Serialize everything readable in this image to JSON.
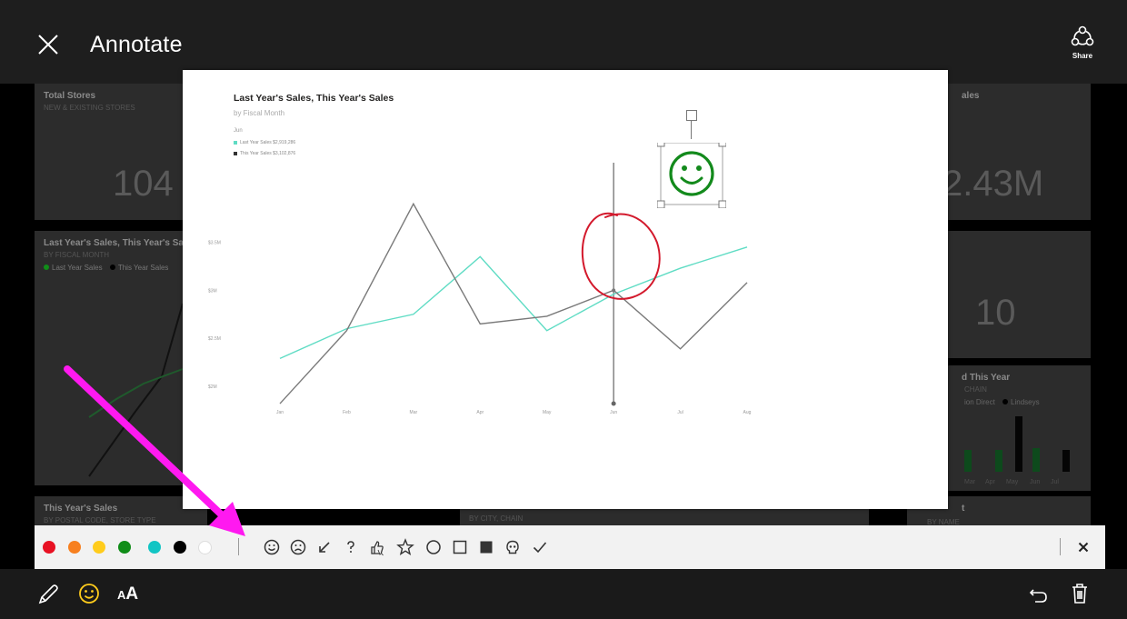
{
  "header": {
    "title": "Annotate",
    "share_label": "Share"
  },
  "background_dashboard": {
    "tile_total_stores": {
      "title": "Total Stores",
      "subtitle": "NEW & EXISTING STORES",
      "value": "104"
    },
    "tile_sales": {
      "title": "ales",
      "value": "2.43M"
    },
    "tile_count": {
      "value": "10"
    },
    "tile_line": {
      "title": "Last Year's Sales, This Year's Sa",
      "subtitle": "BY FISCAL MONTH",
      "legend": [
        "Last Year Sales",
        "This Year Sales"
      ]
    },
    "tile_bar": {
      "title": "d This Year",
      "subtitle": "CHAIN",
      "legend": [
        "ion Direct",
        "Lindseys"
      ],
      "xticks": [
        "Mar",
        "Apr",
        "May",
        "Jun",
        "Jul"
      ]
    },
    "tile_this_year": {
      "title": "This Year's Sales",
      "subtitle": "BY POSTAL CODE, STORE TYPE"
    },
    "tile_mid": {
      "subtitle": "BY CITY, CHAIN"
    },
    "tile_right": {
      "title": "t",
      "subtitle": "BY NAME"
    }
  },
  "chart_data": {
    "type": "line",
    "title": "Last Year's Sales, This Year's Sales",
    "subtitle": "by Fiscal Month",
    "legend_header": "Jun",
    "categories": [
      "Jan",
      "Feb",
      "Mar",
      "Apr",
      "May",
      "Jun",
      "Jul",
      "Aug"
    ],
    "y_ticks": [
      "$3.5M",
      "$3M",
      "$2.5M",
      "$2M"
    ],
    "ylim": [
      1.65,
      4.3
    ],
    "series": [
      {
        "name": "Last Year Sales",
        "legend_label": "Last Year Sales $2,919,286",
        "color": "#5fdcc4",
        "values": [
          2.29,
          2.6,
          2.75,
          3.35,
          2.58,
          2.96,
          3.23,
          3.45
        ]
      },
      {
        "name": "This Year Sales",
        "legend_label": "This Year Sales $3,102,876",
        "color": "#7a7a7a",
        "values": [
          1.82,
          2.58,
          3.9,
          2.65,
          2.73,
          3.0,
          2.39,
          3.08
        ]
      }
    ],
    "cursor_category": "Jun",
    "grid": false
  },
  "toolbar": {
    "colors": [
      "#e81123",
      "#f7801f",
      "#ffcc1c",
      "#108d18",
      "#12c5c4",
      "#000000",
      "#ffffff"
    ],
    "tools": [
      "smile-icon",
      "frown-icon",
      "arrow-icon",
      "question-icon",
      "thumb-icon",
      "star-icon",
      "circle-icon",
      "square-icon",
      "filled-square-icon",
      "skull-icon",
      "check-icon"
    ]
  },
  "annotation": {
    "arrow_color": "#ff19f0",
    "circle_color": "#d3192c",
    "smiley_color": "#138a1c"
  }
}
